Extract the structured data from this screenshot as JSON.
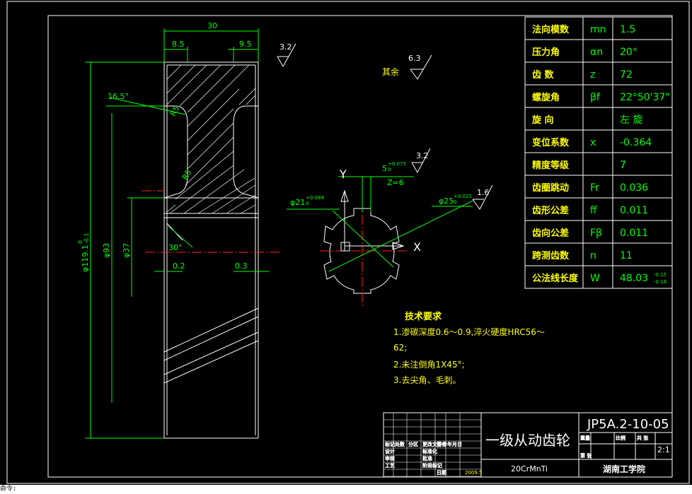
{
  "drawing": {
    "title": "一级从动齿轮",
    "drawing_no": "JP5A.2-10-05",
    "material": "20CrMnTi",
    "scale": "2:1",
    "school": "湖南工学院",
    "date": "2009.5",
    "tech_requirements": {
      "heading": "技术要求",
      "items": [
        "1.渗碳深度0.6～0.9,淬火硬度HRC56～",
        "62;",
        "2.未注倒角1X45°;",
        "3.去尖角、毛刺。"
      ]
    },
    "params": [
      {
        "name": "法向模数",
        "symbol": "mn",
        "value": "1.5"
      },
      {
        "name": "压力角",
        "symbol": "αn",
        "value": "20°"
      },
      {
        "name": "齿 数",
        "symbol": "z",
        "value": "72"
      },
      {
        "name": "螺旋角",
        "symbol": "βf",
        "value": "22°50'37\""
      },
      {
        "name": "旋 向",
        "symbol": "",
        "value": "左 旋"
      },
      {
        "name": "变位系数",
        "symbol": "x",
        "value": "-0.364"
      },
      {
        "name": "精度等级",
        "symbol": "",
        "value": "7"
      },
      {
        "name": "齿圈跳动",
        "symbol": "Fr",
        "value": "0.036"
      },
      {
        "name": "齿形公差",
        "symbol": "ff",
        "value": "0.011"
      },
      {
        "name": "齿向公差",
        "symbol": "Fβ",
        "value": "0.011"
      },
      {
        "name": "跨测齿数",
        "symbol": "n",
        "value": "11"
      },
      {
        "name": "公法线长度",
        "symbol": "W",
        "value": "48.03"
      }
    ],
    "w_tol_upper": "-0.15",
    "w_tol_lower": "-0.18",
    "dims": {
      "width": "30",
      "left": "8.5",
      "right": "9.5",
      "rough_top": "3.2",
      "rough_rest": "6.3",
      "rough_rest_label": "其余",
      "angle": "16.5°",
      "r1": "R5",
      "r2": "R5",
      "od": "φ119.1",
      "od_tol_u": "0",
      "od_tol_l": "-0.1",
      "d93": "φ93",
      "d37": "φ37",
      "chamfer": "30°",
      "gap_left": "0.2",
      "gap_right": "0.3",
      "spline_w": "5",
      "spline_w_tol": "+0.075",
      "spline_w_tol2": "0",
      "z6": "Z=6",
      "rough_spline": "3.2",
      "d21": "φ21",
      "d21_tol": "+0.084",
      "d21_tol2": "0",
      "d25": "φ25",
      "d25_tol": "+0.021",
      "d25_tol2": "0",
      "rough_bore": "1.6",
      "axis_x": "X",
      "axis_y": "Y"
    },
    "title_block_small": [
      "标记",
      "处数",
      "分区",
      "更改文件号",
      "签名",
      "年月日",
      "设计",
      "审核",
      "工艺",
      "标准化",
      "批准",
      "阶段标记",
      "重量",
      "比例",
      "共 张",
      "第 张",
      "日期"
    ],
    "command_line": "命令:"
  }
}
